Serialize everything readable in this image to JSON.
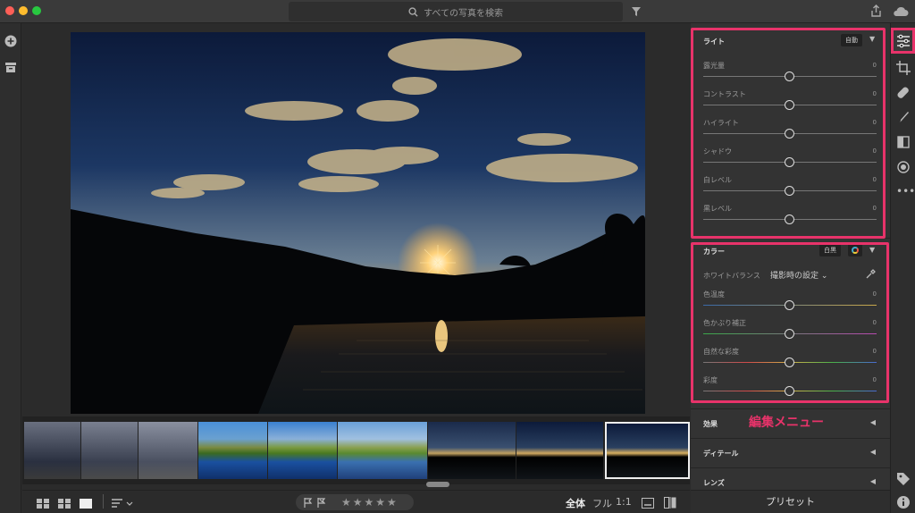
{
  "search": {
    "placeholder": "すべての写真を検索"
  },
  "light": {
    "title": "ライト",
    "auto_label": "自動",
    "sliders": [
      {
        "label": "露光量",
        "value": "0"
      },
      {
        "label": "コントラスト",
        "value": "0"
      },
      {
        "label": "ハイライト",
        "value": "0"
      },
      {
        "label": "シャドウ",
        "value": "0"
      },
      {
        "label": "白レベル",
        "value": "0"
      },
      {
        "label": "黒レベル",
        "value": "0"
      }
    ]
  },
  "color": {
    "title": "カラー",
    "bw_label": "白黒",
    "wb_label": "ホワイトバランス",
    "wb_value": "撮影時の設定",
    "sliders": [
      {
        "label": "色温度",
        "value": "0"
      },
      {
        "label": "色かぶり補正",
        "value": "0"
      },
      {
        "label": "自然な彩度",
        "value": "0"
      },
      {
        "label": "彩度",
        "value": "0"
      }
    ]
  },
  "sections": {
    "effects": "効果",
    "detail": "ディテール",
    "lens": "レンズ"
  },
  "presets_label": "プリセット",
  "annotation": "編集メニュー",
  "view": {
    "all": "全体",
    "full": "フル",
    "one_to_one": "1:1"
  },
  "rating": {
    "stars": "★★★★★"
  },
  "colors": {
    "highlight": "#e8336a",
    "panel": "#333333",
    "background": "#2b2b2b"
  }
}
